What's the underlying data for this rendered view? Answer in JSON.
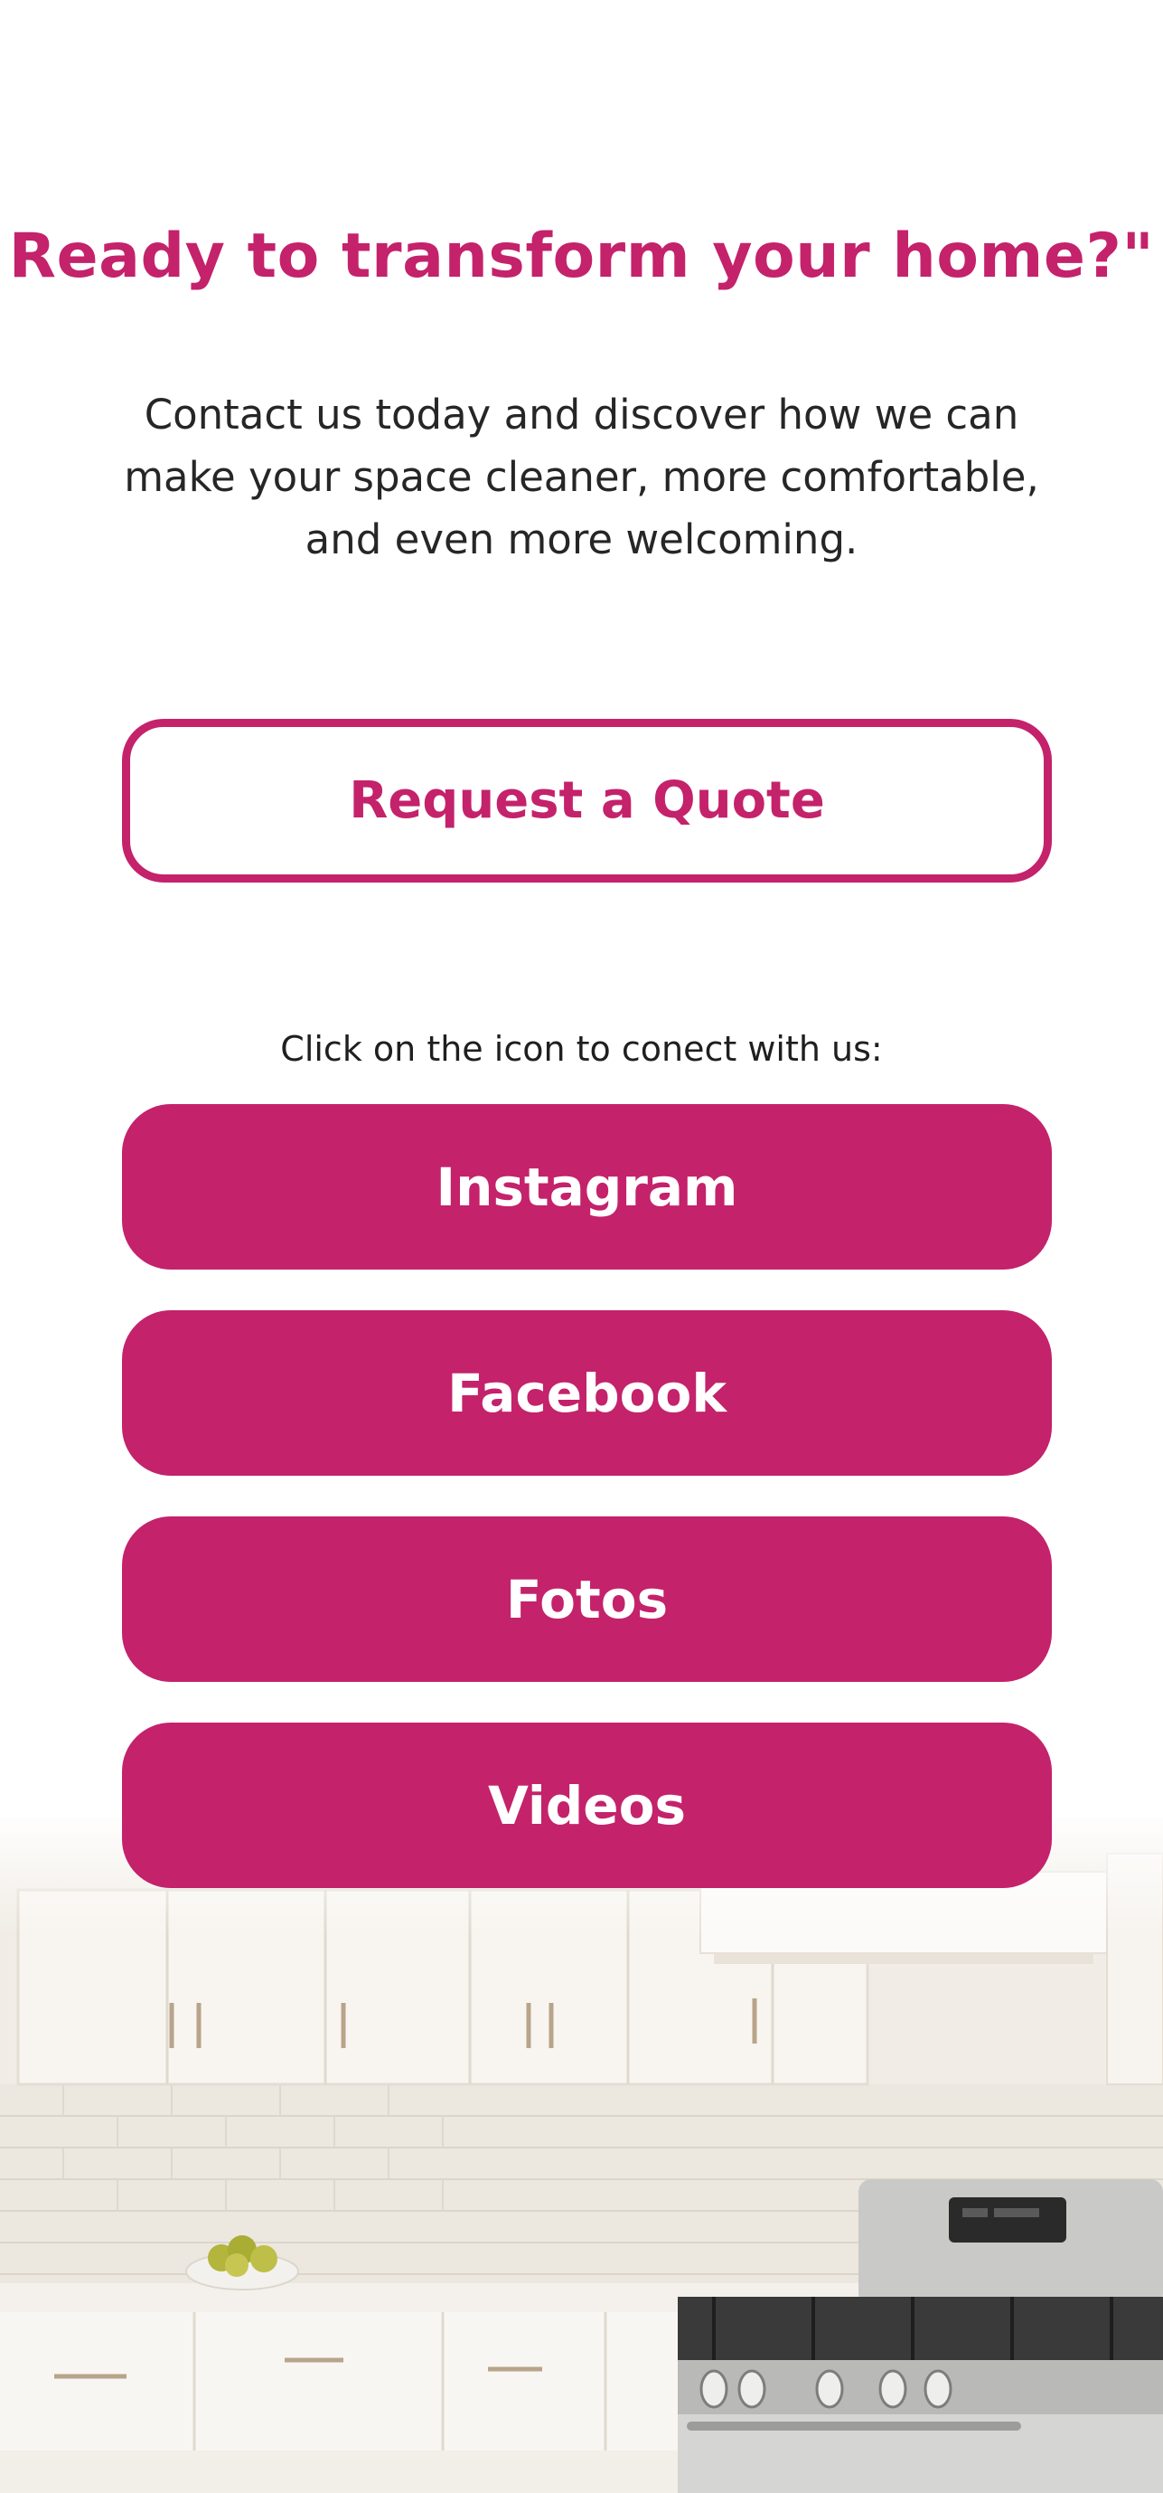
{
  "theme": {
    "accent": "#c4226b",
    "text": "#222222",
    "background": "#ffffff"
  },
  "cta": {
    "title": "Ready to transform your home?\"",
    "description": "Contact us today and discover how we can make your space cleaner, more comfortable, and even more welcoming.",
    "quote_button": "Request a Quote"
  },
  "connect": {
    "label": "Click on the icon to conect with us:",
    "buttons": [
      {
        "label": "Instagram"
      },
      {
        "label": "Facebook"
      },
      {
        "label": "Fotos"
      },
      {
        "label": "Videos"
      }
    ]
  },
  "background_image": {
    "icon": "kitchen-photo"
  }
}
